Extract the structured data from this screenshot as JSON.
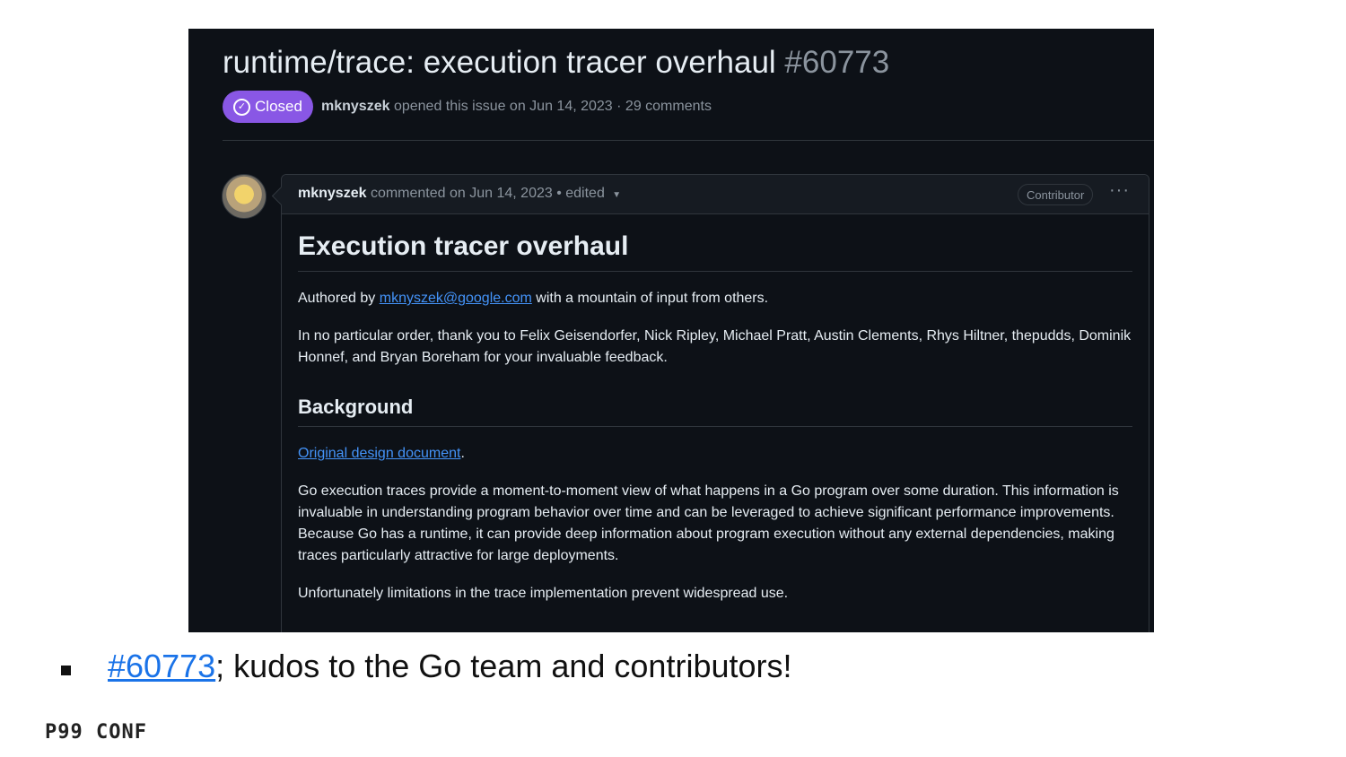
{
  "issue": {
    "title": "runtime/trace: execution tracer overhaul",
    "number": "#60773",
    "state": "Closed",
    "author": "mknyszek",
    "meta_text": "opened this issue on Jun 14, 2023 · 29 comments"
  },
  "comment": {
    "author": "mknyszek",
    "meta_text": "commented on Jun 14, 2023 • edited",
    "badge": "Contributor",
    "more": "···",
    "heading": "Execution tracer overhaul",
    "authored_prefix": "Authored by",
    "authored_email": "mknyszek@google.com",
    "authored_suffix": "with a mountain of input from others.",
    "thanks": "In no particular order, thank you to Felix Geisendorfer, Nick Ripley, Michael Pratt, Austin Clements, Rhys Hiltner, thepudds, Dominik Honnef, and Bryan Boreham for your invaluable feedback.",
    "background_heading": "Background",
    "design_link": "Original design document",
    "design_suffix": ".",
    "para1": "Go execution traces provide a moment-to-moment view of what happens in a Go program over some duration. This information is invaluable in understanding program behavior over time and can be leveraged to achieve significant performance improvements. Because Go has a runtime, it can provide deep information about program execution without any external dependencies, making traces particularly attractive for large deployments.",
    "para2": "Unfortunately limitations in the trace implementation prevent widespread use."
  },
  "slide": {
    "link_text": "#60773",
    "caption_rest": "; kudos to the Go team and contributors!",
    "logo": "P99 CONF"
  },
  "colors": {
    "closed_badge": "#8957e5",
    "background": "#0d1117",
    "link": "#4493f8"
  }
}
